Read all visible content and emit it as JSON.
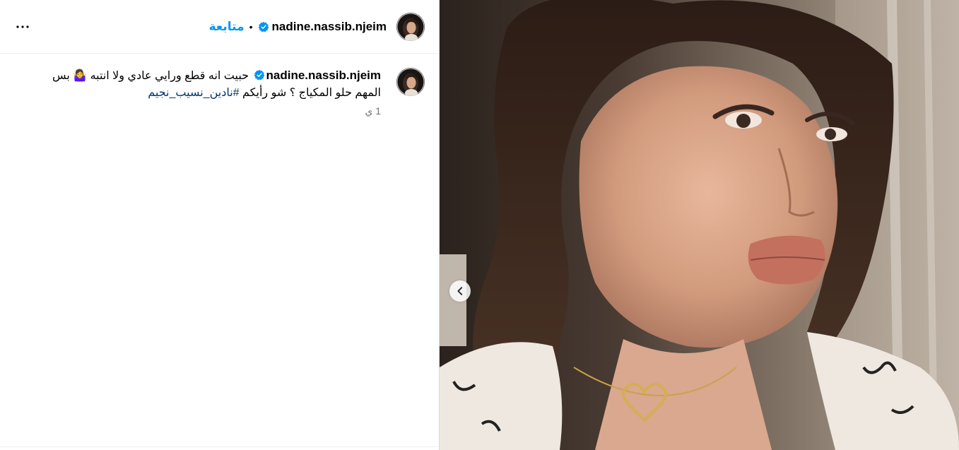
{
  "header": {
    "username": "nadine.nassib.njeim",
    "separator": "•",
    "follow_label": "متابعة",
    "more_icon": "more-horizontal-icon"
  },
  "caption": {
    "username": "nadine.nassib.njeim",
    "text_line1": "حبيت انه قطع ورايي عادي ولا انتبه 🤷‍♀️ بس",
    "text_line2": "المهم حلو المكياج ؟ شو رأيكم",
    "hashtag": "#نادين_نسيب_نجيم",
    "time": "1 ي"
  },
  "media": {
    "alt": "",
    "prev_icon": "chevron-left-icon"
  },
  "colors": {
    "link": "#0095f6",
    "hashtag": "#00376b",
    "verified": "#0095f6",
    "muted": "#737373"
  }
}
